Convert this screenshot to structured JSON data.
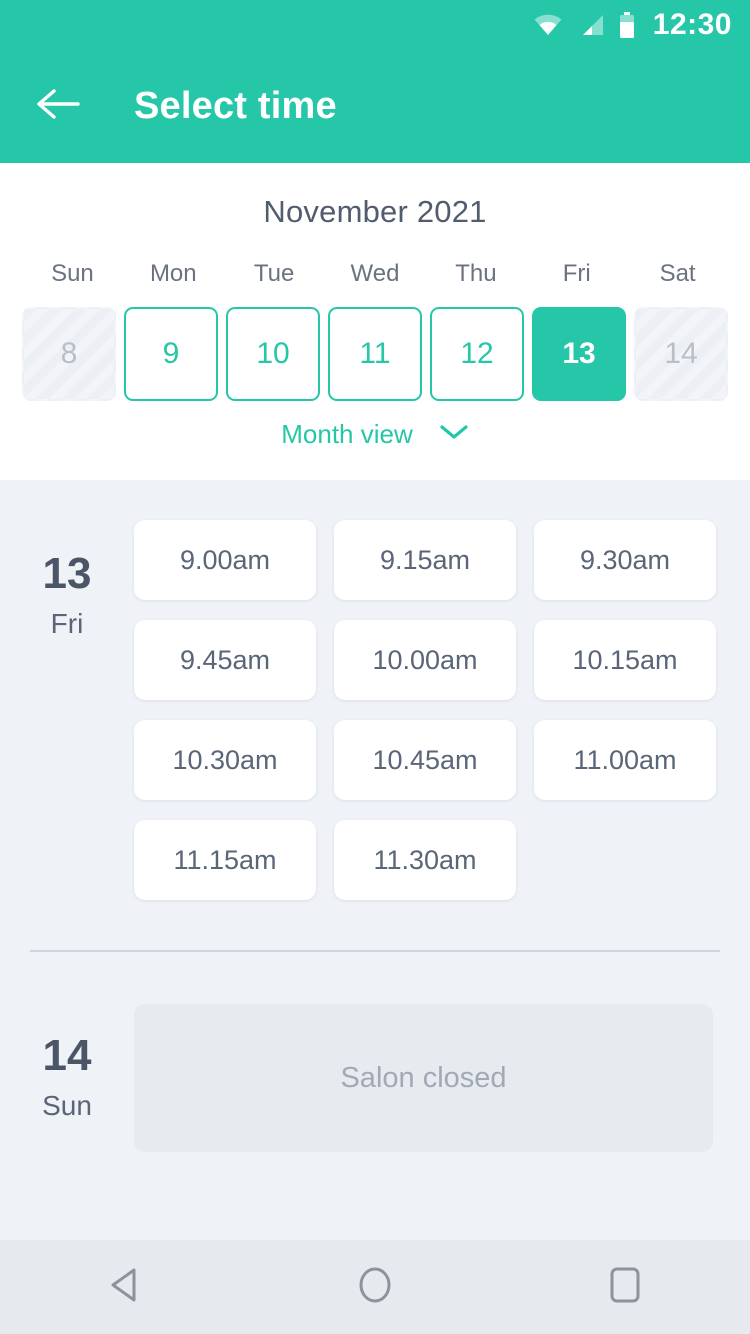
{
  "statusbar": {
    "time": "12:30",
    "icons": [
      "wifi-icon",
      "signal-icon",
      "battery-icon"
    ]
  },
  "appbar": {
    "title": "Select time",
    "back_icon": "arrow-left-icon"
  },
  "calendar": {
    "month_title": "November 2021",
    "weekdays": [
      "Sun",
      "Mon",
      "Tue",
      "Wed",
      "Thu",
      "Fri",
      "Sat"
    ],
    "days": [
      {
        "number": "8",
        "state": "disabled"
      },
      {
        "number": "9",
        "state": "available"
      },
      {
        "number": "10",
        "state": "available"
      },
      {
        "number": "11",
        "state": "available"
      },
      {
        "number": "12",
        "state": "available"
      },
      {
        "number": "13",
        "state": "selected"
      },
      {
        "number": "14",
        "state": "disabled"
      }
    ],
    "month_view_label": "Month view",
    "month_view_icon": "chevron-down-icon"
  },
  "schedule": [
    {
      "day_number": "13",
      "day_of_week": "Fri",
      "slots": [
        "9.00am",
        "9.15am",
        "9.30am",
        "9.45am",
        "10.00am",
        "10.15am",
        "10.30am",
        "10.45am",
        "11.00am",
        "11.15am",
        "11.30am"
      ]
    },
    {
      "day_number": "14",
      "day_of_week": "Sun",
      "closed_label": "Salon closed"
    }
  ],
  "navbar": {
    "back_icon": "nav-back-triangle-icon",
    "home_icon": "nav-home-circle-icon",
    "recents_icon": "nav-recents-square-icon"
  },
  "colors": {
    "accent": "#26c6a8",
    "page_bg": "#eff2f7",
    "card_bg": "#ffffff",
    "text_dark": "#4a5568",
    "text_muted": "#a2a9b6",
    "closed_bg": "#e7eaef",
    "navbar_bg": "#e6e9ed"
  }
}
